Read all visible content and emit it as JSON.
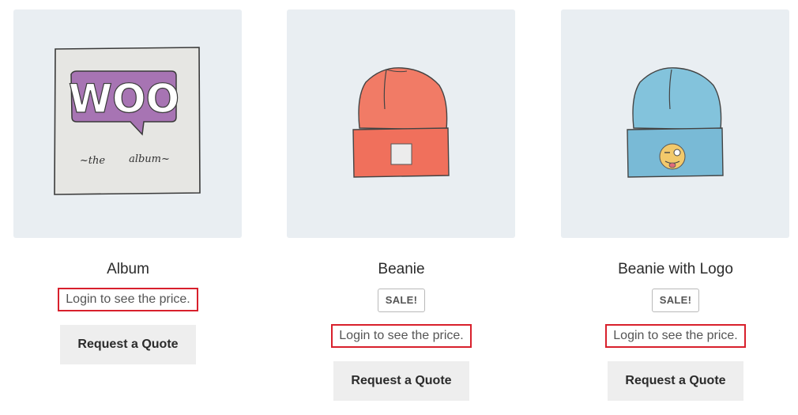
{
  "products": [
    {
      "title": "Album",
      "image_icon": "woo-album-cover-icon",
      "image_text": [
        "WOO",
        "~the",
        "album~"
      ],
      "sale_badge": null,
      "price_note": "Login to see the price.",
      "button_label": "Request a Quote"
    },
    {
      "title": "Beanie",
      "image_icon": "orange-beanie-icon",
      "sale_badge": "SALE!",
      "price_note": "Login to see the price.",
      "button_label": "Request a Quote"
    },
    {
      "title": "Beanie with Logo",
      "image_icon": "blue-beanie-logo-icon",
      "sale_badge": "SALE!",
      "price_note": "Login to see the price.",
      "button_label": "Request a Quote"
    }
  ],
  "colors": {
    "image_background": "#e9eef2",
    "highlight_border": "#d8202c",
    "button_background": "#eeeeee"
  }
}
